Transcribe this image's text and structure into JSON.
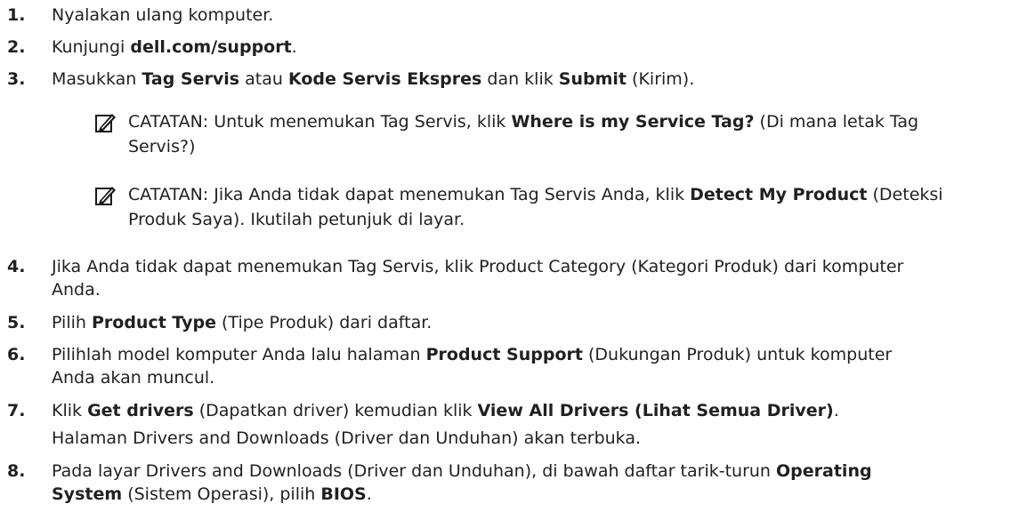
{
  "steps": [
    {
      "num": "1.",
      "parts": [
        {
          "t": "Nyalakan ulang komputer.",
          "b": false
        }
      ]
    },
    {
      "num": "2.",
      "parts": [
        {
          "t": "Kunjungi ",
          "b": false
        },
        {
          "t": "dell.com/support",
          "b": true
        },
        {
          "t": ".",
          "b": false
        }
      ]
    },
    {
      "num": "3.",
      "parts": [
        {
          "t": "Masukkan ",
          "b": false
        },
        {
          "t": "Tag Servis",
          "b": true
        },
        {
          "t": " atau ",
          "b": false
        },
        {
          "t": "Kode Servis Ekspres",
          "b": true
        },
        {
          "t": " dan klik ",
          "b": false
        },
        {
          "t": "Submit",
          "b": true
        },
        {
          "t": " (Kirim).",
          "b": false
        }
      ]
    }
  ],
  "notes": [
    {
      "label": "CATATAN:",
      "parts": [
        {
          "t": " Untuk menemukan Tag Servis, klik ",
          "b": false
        },
        {
          "t": "Where is my Service Tag?",
          "b": true
        },
        {
          "t": " (Di mana letak Tag",
          "b": false
        }
      ],
      "line2": "Servis?)",
      "icon": "pencil-note-icon"
    },
    {
      "label": "CATATAN:",
      "parts": [
        {
          "t": " Jika Anda tidak dapat menemukan Tag Servis Anda, klik ",
          "b": false
        },
        {
          "t": "Detect My Product",
          "b": true
        },
        {
          "t": " (Deteksi",
          "b": false
        }
      ],
      "line2": "Produk Saya). Ikutilah petunjuk di layar.",
      "icon": "pencil-note-icon"
    }
  ],
  "steps2": [
    {
      "num": "4.",
      "line1": [
        {
          "t": "Jika Anda tidak dapat menemukan Tag Servis, klik Product Category (Kategori Produk) dari komputer",
          "b": false
        }
      ],
      "line2": [
        {
          "t": "Anda.",
          "b": false
        }
      ]
    },
    {
      "num": "5.",
      "line1": [
        {
          "t": "Pilih ",
          "b": false
        },
        {
          "t": "Product Type",
          "b": true
        },
        {
          "t": " (Tipe Produk) dari daftar.",
          "b": false
        }
      ],
      "line2": []
    },
    {
      "num": "6.",
      "line1": [
        {
          "t": "Pilihlah model komputer Anda lalu halaman ",
          "b": false
        },
        {
          "t": "Product Support",
          "b": true
        },
        {
          "t": " (Dukungan Produk) untuk komputer",
          "b": false
        }
      ],
      "line2": [
        {
          "t": "Anda akan muncul.",
          "b": false
        }
      ]
    },
    {
      "num": "7.",
      "line1": [
        {
          "t": "Klik ",
          "b": false
        },
        {
          "t": "Get drivers",
          "b": true
        },
        {
          "t": " (Dapatkan driver) kemudian klik ",
          "b": false
        },
        {
          "t": "View All Drivers (Lihat Semua Driver)",
          "b": true
        },
        {
          "t": ".",
          "b": false
        }
      ],
      "line2": [
        {
          "t": "Halaman Drivers and Downloads (Driver dan Unduhan) akan terbuka.",
          "b": false
        }
      ]
    },
    {
      "num": "8.",
      "line1": [
        {
          "t": "Pada layar Drivers and Downloads (Driver dan Unduhan), di bawah daftar tarik-turun ",
          "b": false
        },
        {
          "t": "Operating",
          "b": true
        }
      ],
      "line2": [
        {
          "t": "System",
          "b": true
        },
        {
          "t": " (Sistem Operasi), pilih ",
          "b": false
        },
        {
          "t": "BIOS",
          "b": true
        },
        {
          "t": ".",
          "b": false
        }
      ]
    }
  ]
}
